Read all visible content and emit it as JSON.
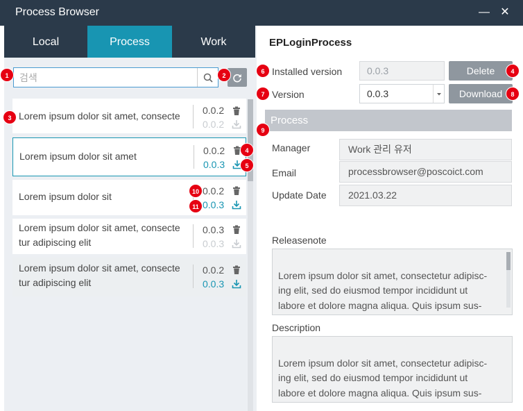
{
  "window": {
    "title": "Process Browser",
    "minimize_glyph": "—",
    "close_glyph": "✕"
  },
  "tabs": [
    {
      "label": "Local",
      "active": false
    },
    {
      "label": "Process",
      "active": true
    },
    {
      "label": "Work",
      "active": false
    }
  ],
  "search": {
    "placeholder": "검색",
    "value": ""
  },
  "list": [
    {
      "name_lines": [
        "Lorem ipsum dolor sit amet, consecte"
      ],
      "installed": "0.0.2",
      "latest": "0.0.2",
      "download_enabled": false,
      "state": "normal"
    },
    {
      "name_lines": [
        "Lorem ipsum dolor sit amet"
      ],
      "installed": "0.0.2",
      "latest": "0.0.3",
      "download_enabled": true,
      "state": "selected"
    },
    {
      "name_lines": [
        "Lorem ipsum dolor sit"
      ],
      "installed": "0.0.2",
      "latest": "0.0.3",
      "download_enabled": true,
      "state": "normal"
    },
    {
      "name_lines": [
        "Lorem ipsum dolor sit amet, consecte",
        "tur adipiscing elit"
      ],
      "installed": "0.0.3",
      "latest": "0.0.3",
      "download_enabled": false,
      "state": "normal"
    },
    {
      "name_lines": [
        "Lorem ipsum dolor sit amet, consecte",
        "tur adipiscing elit"
      ],
      "installed": "0.0.2",
      "latest": "0.0.3",
      "download_enabled": true,
      "state": "hover"
    }
  ],
  "detail": {
    "process_name": "EPLoginProcess",
    "installed_version_label": "Installed version",
    "installed_version_value": "0.0.3",
    "delete_label": "Delete",
    "version_label": "Version",
    "version_selected": "0.0.3",
    "download_label": "Download",
    "section_title": "Process",
    "manager_label": "Manager",
    "manager_value": "Work 관리 유저",
    "email_label": "Email",
    "email_value": "processbrowser@poscoict.com",
    "update_date_label": "Update Date",
    "update_date_value": "2021.03.22",
    "releasenote_label": "Releasenote",
    "releasenote_text": "Lorem ipsum dolor sit amet, consectetur adipisc-\ning elit, sed do eiusmod tempor incididunt ut\nlabore et dolore magna aliqua. Quis ipsum sus-\npendisse ultrices gravida. Risus commodo viverra",
    "description_label": "Description",
    "description_text": "Lorem ipsum dolor sit amet, consectetur adipisc-\ning elit, sed do eiusmod tempor incididunt ut\nlabore et dolore magna aliqua. Quis ipsum sus-\npendisse ultrices gravida. Risus commodo viverra"
  },
  "annotations": [
    "1",
    "2",
    "3",
    "4",
    "5",
    "6",
    "7",
    "8",
    "9",
    "10",
    "11",
    "4"
  ],
  "colors": {
    "titlebar": "#2b3a4a",
    "accent": "#1895b2",
    "badge": "#e60012",
    "button": "#8f979f",
    "disabled_icon": "#c8ccd0"
  }
}
